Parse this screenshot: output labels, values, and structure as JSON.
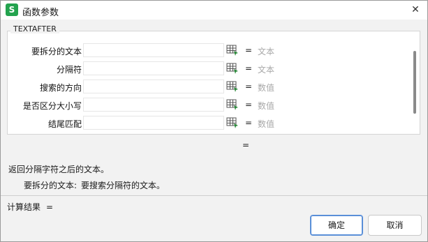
{
  "window": {
    "icon_letter": "S",
    "title": "函数参数",
    "close_glyph": "✕"
  },
  "function_name": "TEXTAFTER",
  "args": [
    {
      "label": "要拆分的文本",
      "equals": "=",
      "hint": "文本"
    },
    {
      "label": "分隔符",
      "equals": "=",
      "hint": "文本"
    },
    {
      "label": "搜索的方向",
      "equals": "=",
      "hint": "数值"
    },
    {
      "label": "是否区分大小写",
      "equals": "=",
      "hint": "数值"
    },
    {
      "label": "结尾匹配",
      "equals": "=",
      "hint": "数值"
    }
  ],
  "result_equals": "=",
  "description": "返回分隔字符之后的文本。",
  "param_description": {
    "name": "要拆分的文本:",
    "text": "要搜索分隔符的文本。"
  },
  "result": {
    "label": "计算结果",
    "equals": "="
  },
  "buttons": {
    "ok": "确定",
    "cancel": "取消"
  },
  "icons": {
    "ref": "range-select-icon"
  }
}
